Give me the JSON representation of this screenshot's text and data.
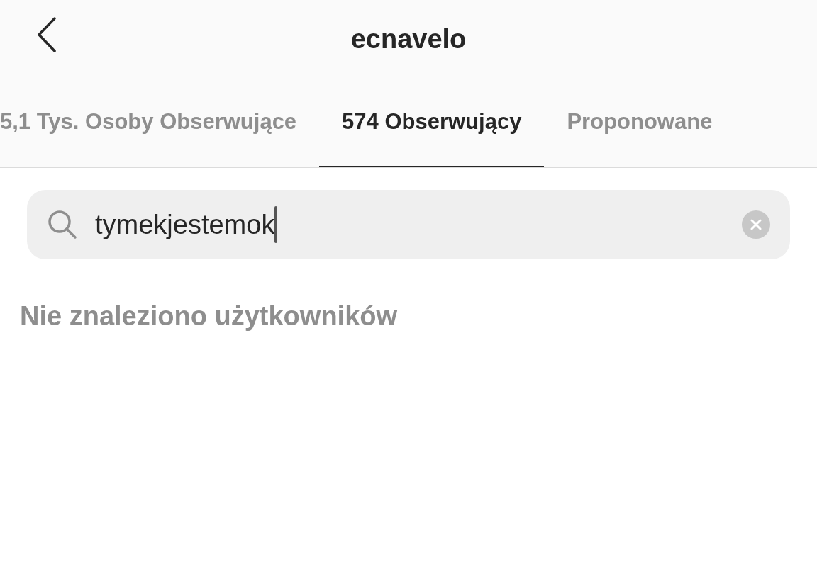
{
  "header": {
    "title": "ecnavelo"
  },
  "tabs": [
    {
      "label": "5,1 Tys. Osoby Obserwujące",
      "selected": false
    },
    {
      "label": "574 Obserwujący",
      "selected": true
    },
    {
      "label": "Proponowane",
      "selected": false
    }
  ],
  "search": {
    "value": "tymekjestemok"
  },
  "empty_message": "Nie znaleziono użytkowników"
}
